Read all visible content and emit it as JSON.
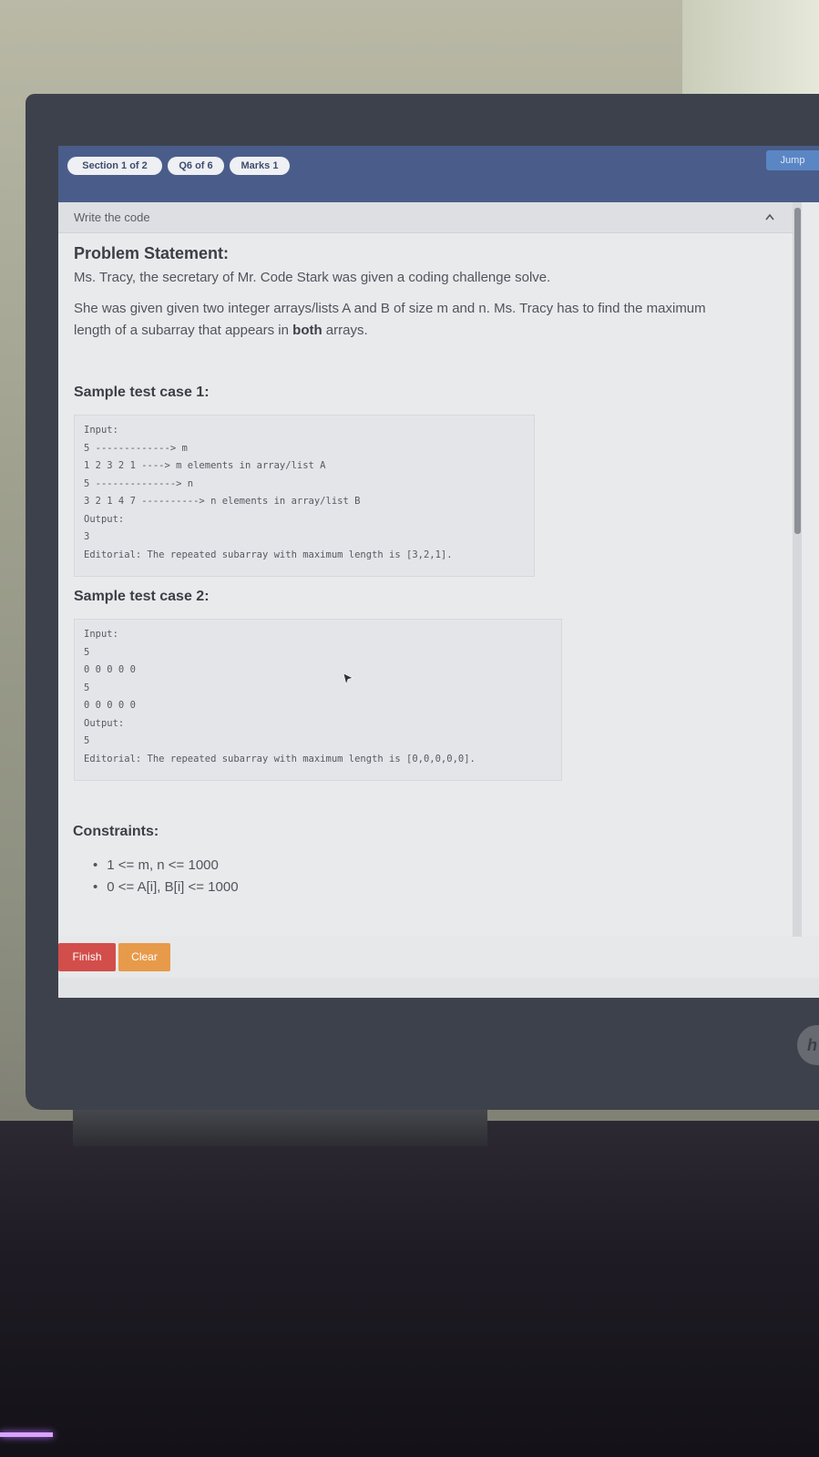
{
  "header": {
    "section": "Section 1 of 2",
    "question": "Q6 of 6",
    "marks": "Marks 1",
    "jump": "Jump"
  },
  "panel": {
    "title": "Write the code"
  },
  "problem": {
    "heading": "Problem Statement:",
    "intro": "Ms. Tracy, the secretary of Mr. Code Stark was given a coding challenge solve.",
    "desc_before": "She was given given two integer arrays/lists A and B of size m and n. Ms. Tracy has to find the maximum length of a subarray that appears in ",
    "desc_bold": "both",
    "desc_after": " arrays."
  },
  "cases": [
    {
      "title": "Sample test case 1:",
      "lines": [
        "Input:",
        "5 -------------> m",
        "1 2 3 2 1 ----> m elements in array/list A",
        "5 --------------> n",
        "3 2 1 4 7 ----------> n elements in array/list B",
        "Output:",
        "3",
        "Editorial: The repeated subarray with maximum length is [3,2,1]."
      ]
    },
    {
      "title": "Sample test case 2:",
      "lines": [
        "Input:",
        "5",
        "0 0 0 0 0",
        "5",
        "0 0 0 0 0",
        "Output:",
        "5",
        "Editorial: The repeated subarray with maximum length is [0,0,0,0,0]."
      ]
    }
  ],
  "constraints": {
    "heading": "Constraints:",
    "items": [
      "1 <= m, n <= 1000",
      "0 <= A[i], B[i] <= 1000"
    ]
  },
  "footer": {
    "finish": "Finish",
    "clear": "Clear"
  },
  "colors": {
    "topbar": "#4a5d8a",
    "finish": "#d24e4a",
    "clear": "#e79a4a"
  }
}
